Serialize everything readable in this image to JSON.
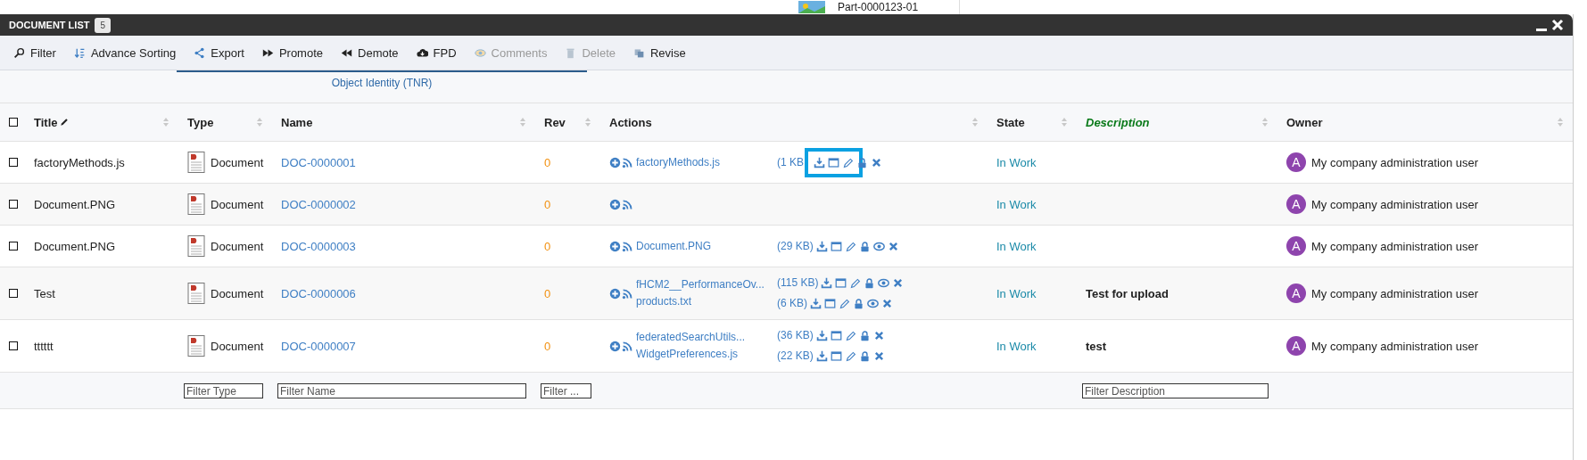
{
  "background": {
    "text": "Part-0000123-01"
  },
  "window": {
    "title": "DOCUMENT LIST",
    "count": "5"
  },
  "toolbar": [
    {
      "label": "Filter",
      "disabled": false
    },
    {
      "label": "Advance Sorting",
      "disabled": false
    },
    {
      "label": "Export",
      "disabled": false
    },
    {
      "label": "Promote",
      "disabled": false
    },
    {
      "label": "Demote",
      "disabled": false
    },
    {
      "label": "FPD",
      "disabled": false
    },
    {
      "label": "Comments",
      "disabled": true
    },
    {
      "label": "Delete",
      "disabled": true
    },
    {
      "label": "Revise",
      "disabled": false
    }
  ],
  "table": {
    "group_header": "Object Identity (TNR)",
    "select_all_checked": false,
    "columns": [
      {
        "label": "Title",
        "editable": true,
        "emphasized": false
      },
      {
        "label": "Type",
        "editable": false,
        "emphasized": false,
        "filter_placeholder": "Filter Type"
      },
      {
        "label": "Name",
        "editable": false,
        "emphasized": false,
        "filter_placeholder": "Filter Name"
      },
      {
        "label": "Rev",
        "editable": false,
        "emphasized": false,
        "filter_placeholder": "Filter ..."
      },
      {
        "label": "Actions",
        "editable": false,
        "emphasized": false
      },
      {
        "label": "State",
        "editable": false,
        "emphasized": false
      },
      {
        "label": "Description",
        "editable": false,
        "emphasized": true,
        "filter_placeholder": "Filter Description"
      },
      {
        "label": "Owner",
        "editable": false,
        "emphasized": false
      }
    ],
    "rows": [
      {
        "checked": false,
        "title": "factoryMethods.js",
        "type": "Document",
        "name": "DOC-0000001",
        "rev": "0",
        "files": [
          {
            "name": "factoryMethods.js",
            "size": "(1 KB",
            "viewable": false,
            "highlighted": true
          }
        ],
        "state": "In Work",
        "owner_initial": "A",
        "owner": "My company administration user"
      },
      {
        "checked": false,
        "title": "Document.PNG",
        "type": "Document",
        "name": "DOC-0000002",
        "rev": "0",
        "state": "In Work",
        "owner_initial": "A",
        "owner": "My company administration user"
      },
      {
        "checked": false,
        "title": "Document.PNG",
        "type": "Document",
        "name": "DOC-0000003",
        "rev": "0",
        "files": [
          {
            "name": "Document.PNG",
            "size": "(29 KB)",
            "viewable": true,
            "highlighted": false
          }
        ],
        "state": "In Work",
        "owner_initial": "A",
        "owner": "My company administration user"
      },
      {
        "checked": false,
        "title": "Test",
        "type": "Document",
        "name": "DOC-0000006",
        "rev": "0",
        "files": [
          {
            "name": "fHCM2__PerformanceOv...",
            "size": "(115 KB)",
            "viewable": true,
            "highlighted": false
          },
          {
            "name": "products.txt",
            "size": "(6 KB)",
            "viewable": true,
            "highlighted": false
          }
        ],
        "state": "In Work",
        "description": "Test for upload",
        "owner_initial": "A",
        "owner": "My company administration user"
      },
      {
        "checked": false,
        "title": "tttttt",
        "type": "Document",
        "name": "DOC-0000007",
        "rev": "0",
        "files": [
          {
            "name": "federatedSearchUtils...",
            "size": "(36 KB)",
            "viewable": false,
            "highlighted": false
          },
          {
            "name": "WidgetPreferences.js",
            "size": "(22 KB)",
            "viewable": false,
            "highlighted": false
          }
        ],
        "state": "In Work",
        "description": "test",
        "owner_initial": "A",
        "owner": "My company administration user"
      }
    ]
  }
}
